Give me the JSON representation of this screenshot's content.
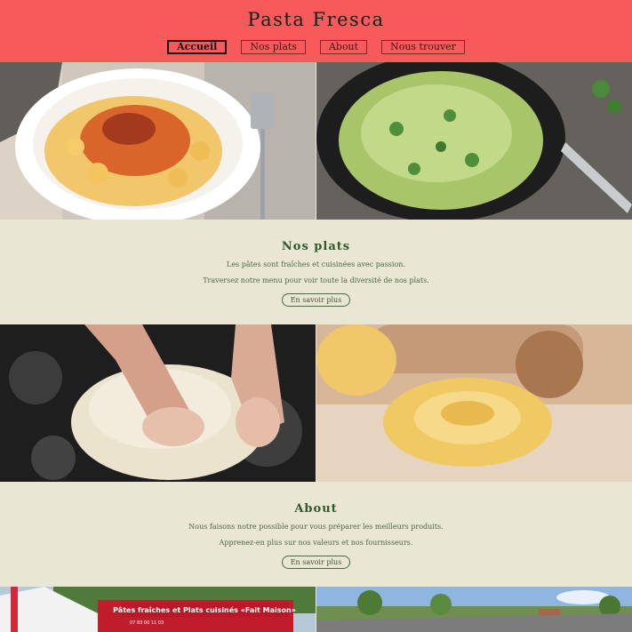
{
  "header": {
    "title": "Pasta Fresca",
    "nav": [
      {
        "label": "Accueil",
        "active": true
      },
      {
        "label": "Nos plats",
        "active": false
      },
      {
        "label": "About",
        "active": false
      },
      {
        "label": "Nous trouver",
        "active": false
      }
    ]
  },
  "sections": {
    "plats": {
      "title": "Nos plats",
      "line1": "Les pâtes sont fraîches et cuisinées avec passion.",
      "line2": "Traversez notre menu pour voir toute la diversité de nos plats.",
      "button": "En savoir plus"
    },
    "about": {
      "title": "About",
      "line1": "Nous faisons notre possible pour vous préparer les meilleurs produits.",
      "line2": "Apprenez-en plus sur nos valeurs et nos fournisseurs.",
      "button": "En savoir plus"
    }
  },
  "images": {
    "truck_sign": "Pâtes fraîches et Plats cuisinés «Fait Maison»",
    "truck_phone": "07 83 00 11 03"
  },
  "colors": {
    "header_bg": "#f85a5b",
    "page_bg": "#eae6d4",
    "section_text": "#2e5a2a"
  }
}
